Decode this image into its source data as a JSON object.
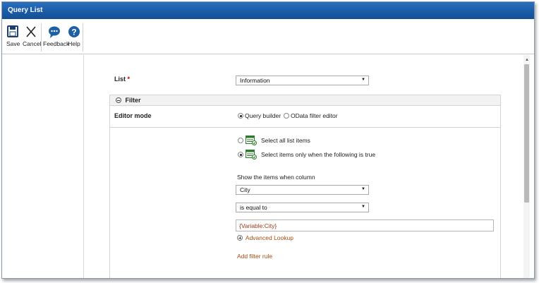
{
  "window": {
    "title": "Query List"
  },
  "toolbar": {
    "save_label": "Save",
    "cancel_label": "Cancel",
    "feedback_label": "Feedback",
    "help_label": "Help",
    "icons": [
      "save-icon",
      "close-icon",
      "feedback-icon",
      "help-icon"
    ]
  },
  "form": {
    "list_label": "List",
    "required_mark": "*",
    "list_value": "Information",
    "filter_section_title": "Filter",
    "editor_mode_label": "Editor mode",
    "editor_mode_options": [
      "Query builder",
      "OData filter editor"
    ],
    "editor_mode_selected": "Query builder",
    "selection_options": [
      "Select all list items",
      "Select items only when the following is true"
    ],
    "selection_selected": "Select items only when the following is true",
    "show_items_label": "Show the items when column",
    "column_value": "City",
    "operator_value": "is equal to",
    "value_input": "{Variable:City}",
    "advanced_lookup_label": "Advanced Lookup",
    "add_filter_rule_label": "Add filter rule"
  },
  "colors": {
    "titlebar": "#1a5aa5",
    "link": "#a64c12",
    "required": "#c00000",
    "icon_blue": "#1f5fa6"
  }
}
